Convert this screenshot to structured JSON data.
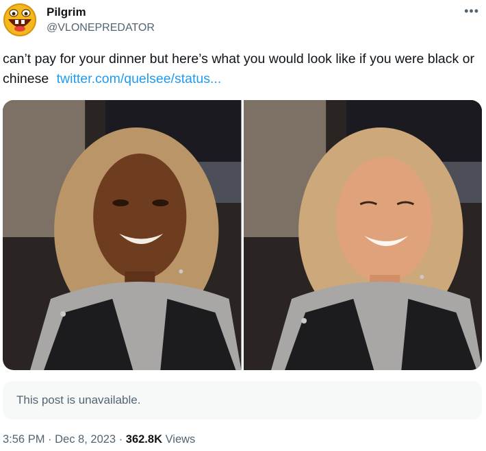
{
  "author": {
    "display_name": "Pilgrim",
    "handle": "@VLONEPREDATOR",
    "avatar_icon": "laughing-emoji-avatar"
  },
  "more_icon": "•••",
  "tweet": {
    "text": "can’t pay for your dinner but here’s what you would look like if you were black or chinese",
    "link": "twitter.com/quelsee/status..."
  },
  "media": [
    {
      "icon": "selfie-photo-dark-skin"
    },
    {
      "icon": "selfie-photo-light-skin"
    }
  ],
  "quoted": {
    "unavailable_text": "This post is unavailable."
  },
  "meta": {
    "time": "3:56 PM",
    "sep1": " · ",
    "date": "Dec 8, 2023",
    "sep2": " · ",
    "views_count": "362.8K",
    "views_label": " Views"
  },
  "colors": {
    "link": "#1d9bf0",
    "secondary": "#536471",
    "unavailable_bg": "#f7f9f9"
  }
}
